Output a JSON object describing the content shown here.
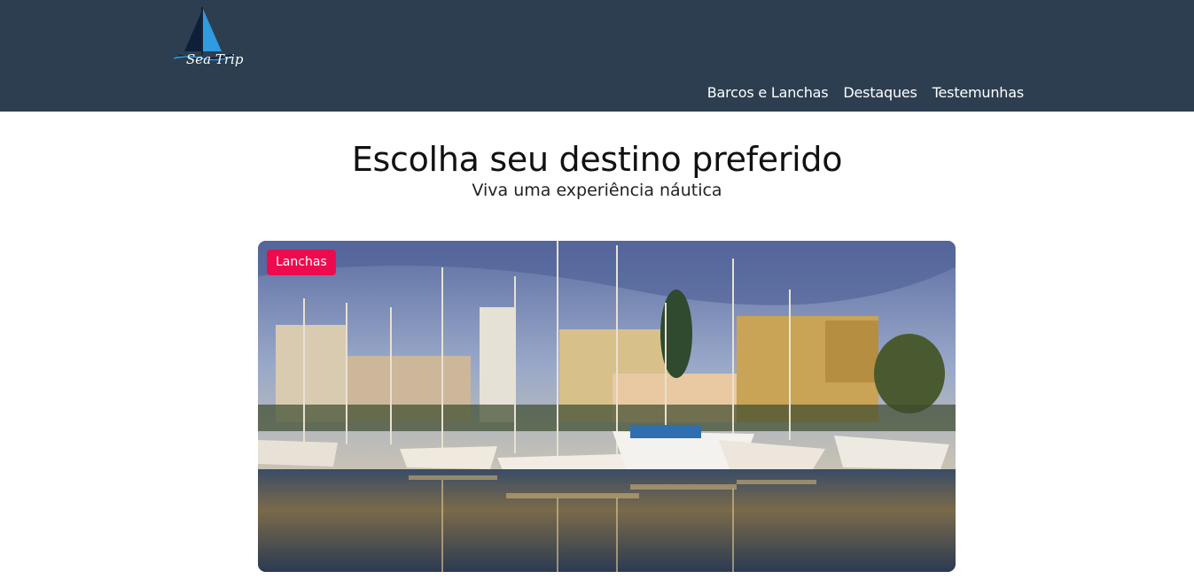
{
  "brand": {
    "logo_text": "Sea Trip",
    "logo_icon": "sailboat-icon"
  },
  "nav": {
    "items": [
      {
        "label": "Barcos e Lanchas"
      },
      {
        "label": "Destaques"
      },
      {
        "label": "Testemunhas"
      }
    ]
  },
  "hero": {
    "title": "Escolha seu destino preferido",
    "subtitle": "Viva uma experiência náutica"
  },
  "card": {
    "badge": "Lanchas",
    "image": "marina-photo",
    "badge_color": "#ee0b4d"
  },
  "colors": {
    "header_bg": "#2d3e50",
    "accent": "#ee0b4d"
  }
}
